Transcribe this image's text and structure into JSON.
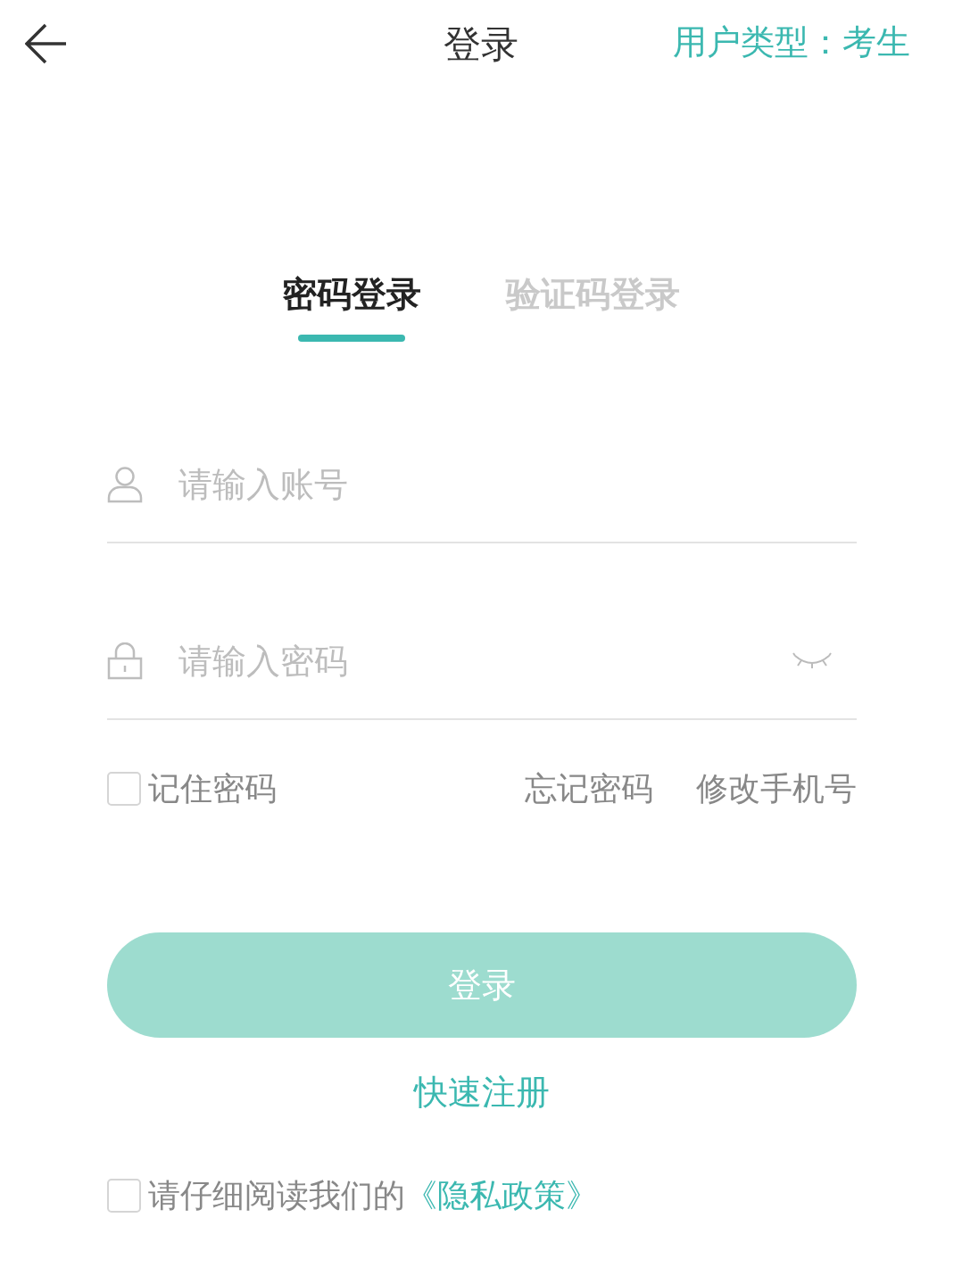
{
  "header": {
    "title": "登录",
    "user_type": "用户类型：考生"
  },
  "tabs": [
    {
      "label": "密码登录",
      "selected": true
    },
    {
      "label": "验证码登录",
      "selected": false
    }
  ],
  "fields": [
    {
      "kind": "account",
      "placeholder": "请输入账号"
    },
    {
      "kind": "password",
      "placeholder": "请输入密码",
      "password_visible": false
    }
  ],
  "remember": {
    "label": "记住密码",
    "checked": false
  },
  "links": [
    "忘记密码",
    "修改手机号"
  ],
  "login_button": {
    "label": "登录",
    "disabled": true
  },
  "register_link": "快速注册",
  "privacy": {
    "checked": false,
    "text": "请仔细阅读我们的",
    "link": "《隐私政策》"
  }
}
